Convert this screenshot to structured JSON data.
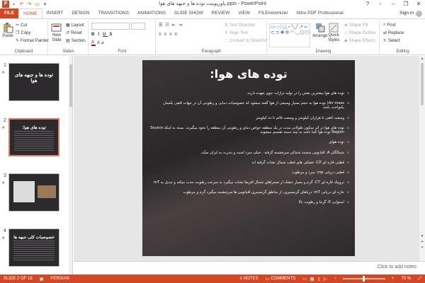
{
  "window": {
    "title": "پاورپوینت توده ها و جبهه های هوا.pptx - PowerPoint",
    "app_icon_label": "P",
    "controls": {
      "help": "?",
      "minimize": "–",
      "restore": "❐",
      "close": "✕"
    }
  },
  "tabs": [
    {
      "label": "FILE"
    },
    {
      "label": "HOME"
    },
    {
      "label": "INSERT"
    },
    {
      "label": "DESIGN"
    },
    {
      "label": "TRANSITIONS"
    },
    {
      "label": "ANIMATIONS"
    },
    {
      "label": "SLIDE SHOW"
    },
    {
      "label": "REVIEW"
    },
    {
      "label": "VIEW"
    },
    {
      "label": "FILEminimizer"
    },
    {
      "label": "Nitro PDF Professional"
    }
  ],
  "sign_in": "Sign in",
  "ribbon": {
    "clipboard": {
      "label": "Clipboard",
      "paste": "Paste",
      "cut": "Cut",
      "copy": "Copy",
      "format_painter": "Format Painter"
    },
    "slides": {
      "label": "Slides",
      "new_slide_line1": "New",
      "new_slide_line2": "Slide",
      "layout": "Layout",
      "reset": "Reset",
      "section": "Section"
    },
    "font": {
      "label": "Font"
    },
    "paragraph": {
      "label": "Paragraph",
      "text_direction": "Text Direction",
      "align_text": "Align Text",
      "convert_smartart": "Convert to SmartArt"
    },
    "drawing": {
      "label": "Drawing",
      "arrange": "Arrange",
      "quick_styles_line1": "Quick",
      "quick_styles_line2": "Styles",
      "shape_fill": "Shape Fill",
      "shape_outline": "Shape Outline",
      "shape_effects": "Shape Effects"
    },
    "editing": {
      "label": "Editing",
      "find": "Find",
      "replace": "Replace",
      "select": "Select"
    }
  },
  "thumbnails": [
    {
      "num": "1",
      "title": "توده ها و جبهه های هوا"
    },
    {
      "num": "2",
      "title": "توده های هوا:"
    },
    {
      "num": "3",
      "title": ""
    },
    {
      "num": "4",
      "title": "خصوصیات کلی جبهه ها"
    }
  ],
  "slide": {
    "title": "توده های هوا:",
    "bullets": [
      "توده های هوا بیشترین نقش را در تولید ترازات جوی بعهده دارند.",
      "Air mass) توده هوا به حجم بسیار وسیعی از هوا گفته میشود که خصوصیات دمایی و رطوبتی آن در جهات افقی یکسان یکنواخت باشد",
      "وسعت افقی تا هزاران کیلومتر و وسعت قائم تا ده کیلومتر",
      "توده های هوا در اثر سکون طولانی مدت در یک منطقه خواص دمای و رطوبتی آن منطقه را بخود میگیرند. بسته به اینکه Source Region توده هوا کجا باشد به چند دسته تقسیم میشوند.",
      "توده هوای",
      "شمالگان A: اقیانوس منجمد شمالی سرچشمه گرفته ، خیلی سرد است و بندرت به ایران میآید.",
      "قطبی قاره ای CP: خشکی های قطب شمال نشات گرفته اند",
      "قطبی دریایی mp: سرد و مرطوب",
      "تروپیک قاره ای CT: گرم و بسیار خشک از صحراهای شمال افریقا نشات میگیرد به سرعت رطوبت جذب میکند و تبدیل به mT",
      "حاره ای دریایی mT: دریاهای گرمسیری، از مناطق گرمسیری اقیانوس ها سرچشمه میگیرد گرم و مرطوب",
      "استوایی E: گرما و رطوبت بالا"
    ]
  },
  "notes_placeholder": "Click to add notes",
  "status": {
    "slide_count": "SLIDE 2 OF 18",
    "language": "PERSIAN",
    "notes": "NOTES",
    "comments": "COMMENTS",
    "zoom": "70 %"
  },
  "colors": {
    "accent": "#d24726",
    "slide_bg": "#2c2a2c"
  }
}
